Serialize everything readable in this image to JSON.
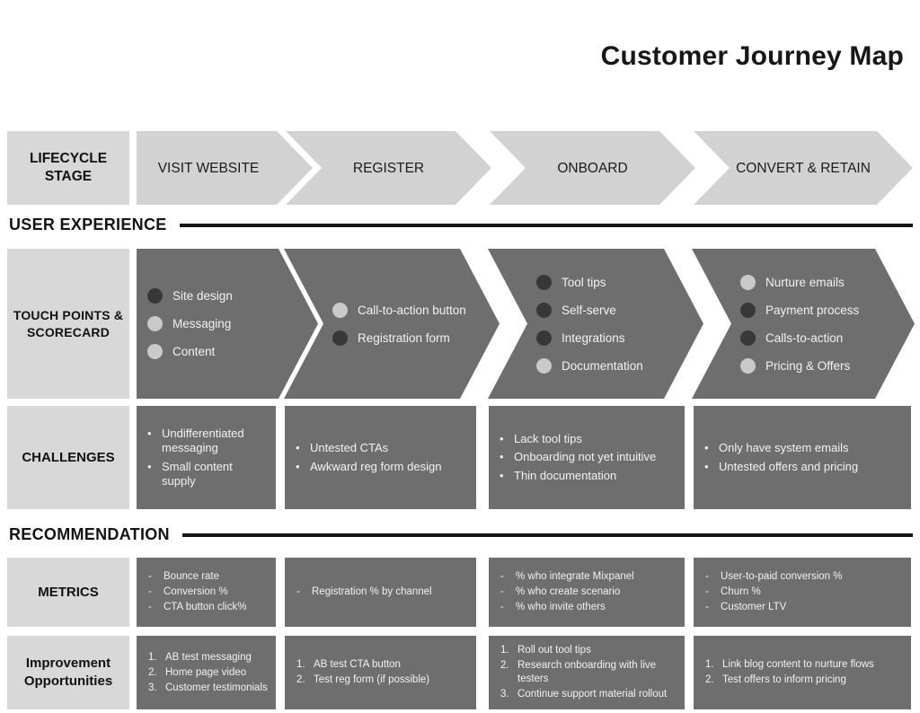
{
  "title": "Customer Journey Map",
  "sections": {
    "user_experience": "USER EXPERIENCE",
    "recommendation": "RECOMMENDATION"
  },
  "rows": {
    "lifecycle": {
      "label": "LIFECYCLE STAGE",
      "stages": [
        "VISIT WEBSITE",
        "REGISTER",
        "ONBOARD",
        "CONVERT & RETAIN"
      ]
    },
    "touchpoints": {
      "label": "TOUCH POINTS & SCORECARD",
      "columns": [
        {
          "items": [
            {
              "text": "Site design",
              "score": "dark"
            },
            {
              "text": "Messaging",
              "score": "light"
            },
            {
              "text": "Content",
              "score": "light"
            }
          ]
        },
        {
          "items": [
            {
              "text": "Call-to-action button",
              "score": "light"
            },
            {
              "text": "Registration form",
              "score": "dark"
            }
          ]
        },
        {
          "items": [
            {
              "text": "Tool tips",
              "score": "dark"
            },
            {
              "text": "Self-serve",
              "score": "dark"
            },
            {
              "text": "Integrations",
              "score": "dark"
            },
            {
              "text": "Documentation",
              "score": "light"
            }
          ]
        },
        {
          "items": [
            {
              "text": "Nurture emails",
              "score": "light"
            },
            {
              "text": "Payment process",
              "score": "dark"
            },
            {
              "text": "Calls-to-action",
              "score": "dark"
            },
            {
              "text": "Pricing & Offers",
              "score": "light"
            }
          ]
        }
      ]
    },
    "challenges": {
      "label": "CHALLENGES",
      "columns": [
        [
          "Undifferentiated messaging",
          "Small content supply"
        ],
        [
          "Untested CTAs",
          "Awkward reg form design"
        ],
        [
          "Lack tool tips",
          "Onboarding not yet intuitive",
          "Thin documentation"
        ],
        [
          "Only have system emails",
          "Untested offers and pricing"
        ]
      ]
    },
    "metrics": {
      "label": "METRICS",
      "columns": [
        [
          "Bounce rate",
          "Conversion %",
          "CTA button click%"
        ],
        [
          "Registration % by channel"
        ],
        [
          "% who integrate Mixpanel",
          "% who create scenario",
          "% who invite others"
        ],
        [
          "User-to-paid conversion %",
          "Churn %",
          "Customer LTV"
        ]
      ]
    },
    "improvement": {
      "label": "Improvement Opportunities",
      "columns": [
        [
          "AB test messaging",
          "Home page video",
          "Customer testimonials"
        ],
        [
          "AB test CTA button",
          "Test reg form (if possible)"
        ],
        [
          "Roll out tool tips",
          "Research onboarding with live testers",
          "Continue support material rollout"
        ],
        [
          "Link blog content to nurture flows",
          "Test offers to inform pricing"
        ]
      ]
    }
  },
  "colors": {
    "label_cell": "#d8d8d8",
    "stage_chevron": "#d2d2d2",
    "dark_cell": "#6e6e6e",
    "dot_dark": "#383838",
    "dot_light": "#c9c9c9",
    "rule": "#161616"
  }
}
